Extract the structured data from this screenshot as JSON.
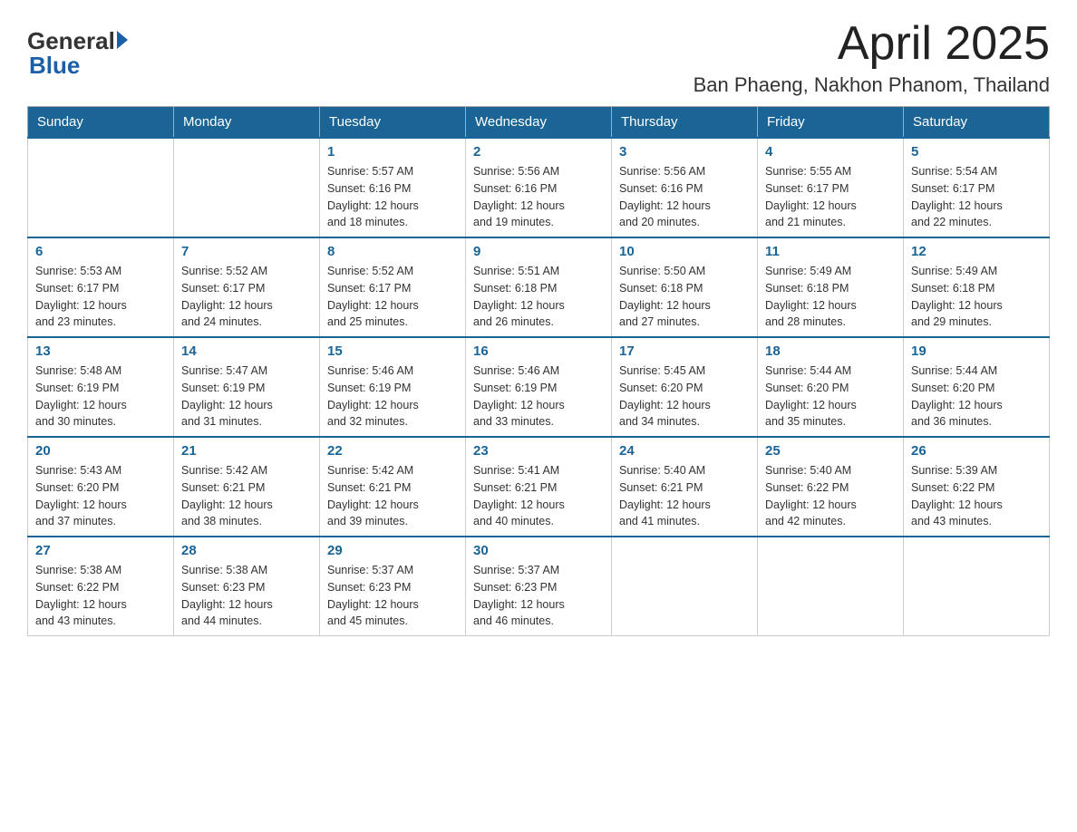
{
  "header": {
    "logo_general": "General",
    "logo_blue": "Blue",
    "month_title": "April 2025",
    "location": "Ban Phaeng, Nakhon Phanom, Thailand"
  },
  "days_of_week": [
    "Sunday",
    "Monday",
    "Tuesday",
    "Wednesday",
    "Thursday",
    "Friday",
    "Saturday"
  ],
  "weeks": [
    [
      {
        "day": "",
        "info": ""
      },
      {
        "day": "",
        "info": ""
      },
      {
        "day": "1",
        "info": "Sunrise: 5:57 AM\nSunset: 6:16 PM\nDaylight: 12 hours\nand 18 minutes."
      },
      {
        "day": "2",
        "info": "Sunrise: 5:56 AM\nSunset: 6:16 PM\nDaylight: 12 hours\nand 19 minutes."
      },
      {
        "day": "3",
        "info": "Sunrise: 5:56 AM\nSunset: 6:16 PM\nDaylight: 12 hours\nand 20 minutes."
      },
      {
        "day": "4",
        "info": "Sunrise: 5:55 AM\nSunset: 6:17 PM\nDaylight: 12 hours\nand 21 minutes."
      },
      {
        "day": "5",
        "info": "Sunrise: 5:54 AM\nSunset: 6:17 PM\nDaylight: 12 hours\nand 22 minutes."
      }
    ],
    [
      {
        "day": "6",
        "info": "Sunrise: 5:53 AM\nSunset: 6:17 PM\nDaylight: 12 hours\nand 23 minutes."
      },
      {
        "day": "7",
        "info": "Sunrise: 5:52 AM\nSunset: 6:17 PM\nDaylight: 12 hours\nand 24 minutes."
      },
      {
        "day": "8",
        "info": "Sunrise: 5:52 AM\nSunset: 6:17 PM\nDaylight: 12 hours\nand 25 minutes."
      },
      {
        "day": "9",
        "info": "Sunrise: 5:51 AM\nSunset: 6:18 PM\nDaylight: 12 hours\nand 26 minutes."
      },
      {
        "day": "10",
        "info": "Sunrise: 5:50 AM\nSunset: 6:18 PM\nDaylight: 12 hours\nand 27 minutes."
      },
      {
        "day": "11",
        "info": "Sunrise: 5:49 AM\nSunset: 6:18 PM\nDaylight: 12 hours\nand 28 minutes."
      },
      {
        "day": "12",
        "info": "Sunrise: 5:49 AM\nSunset: 6:18 PM\nDaylight: 12 hours\nand 29 minutes."
      }
    ],
    [
      {
        "day": "13",
        "info": "Sunrise: 5:48 AM\nSunset: 6:19 PM\nDaylight: 12 hours\nand 30 minutes."
      },
      {
        "day": "14",
        "info": "Sunrise: 5:47 AM\nSunset: 6:19 PM\nDaylight: 12 hours\nand 31 minutes."
      },
      {
        "day": "15",
        "info": "Sunrise: 5:46 AM\nSunset: 6:19 PM\nDaylight: 12 hours\nand 32 minutes."
      },
      {
        "day": "16",
        "info": "Sunrise: 5:46 AM\nSunset: 6:19 PM\nDaylight: 12 hours\nand 33 minutes."
      },
      {
        "day": "17",
        "info": "Sunrise: 5:45 AM\nSunset: 6:20 PM\nDaylight: 12 hours\nand 34 minutes."
      },
      {
        "day": "18",
        "info": "Sunrise: 5:44 AM\nSunset: 6:20 PM\nDaylight: 12 hours\nand 35 minutes."
      },
      {
        "day": "19",
        "info": "Sunrise: 5:44 AM\nSunset: 6:20 PM\nDaylight: 12 hours\nand 36 minutes."
      }
    ],
    [
      {
        "day": "20",
        "info": "Sunrise: 5:43 AM\nSunset: 6:20 PM\nDaylight: 12 hours\nand 37 minutes."
      },
      {
        "day": "21",
        "info": "Sunrise: 5:42 AM\nSunset: 6:21 PM\nDaylight: 12 hours\nand 38 minutes."
      },
      {
        "day": "22",
        "info": "Sunrise: 5:42 AM\nSunset: 6:21 PM\nDaylight: 12 hours\nand 39 minutes."
      },
      {
        "day": "23",
        "info": "Sunrise: 5:41 AM\nSunset: 6:21 PM\nDaylight: 12 hours\nand 40 minutes."
      },
      {
        "day": "24",
        "info": "Sunrise: 5:40 AM\nSunset: 6:21 PM\nDaylight: 12 hours\nand 41 minutes."
      },
      {
        "day": "25",
        "info": "Sunrise: 5:40 AM\nSunset: 6:22 PM\nDaylight: 12 hours\nand 42 minutes."
      },
      {
        "day": "26",
        "info": "Sunrise: 5:39 AM\nSunset: 6:22 PM\nDaylight: 12 hours\nand 43 minutes."
      }
    ],
    [
      {
        "day": "27",
        "info": "Sunrise: 5:38 AM\nSunset: 6:22 PM\nDaylight: 12 hours\nand 43 minutes."
      },
      {
        "day": "28",
        "info": "Sunrise: 5:38 AM\nSunset: 6:23 PM\nDaylight: 12 hours\nand 44 minutes."
      },
      {
        "day": "29",
        "info": "Sunrise: 5:37 AM\nSunset: 6:23 PM\nDaylight: 12 hours\nand 45 minutes."
      },
      {
        "day": "30",
        "info": "Sunrise: 5:37 AM\nSunset: 6:23 PM\nDaylight: 12 hours\nand 46 minutes."
      },
      {
        "day": "",
        "info": ""
      },
      {
        "day": "",
        "info": ""
      },
      {
        "day": "",
        "info": ""
      }
    ]
  ]
}
